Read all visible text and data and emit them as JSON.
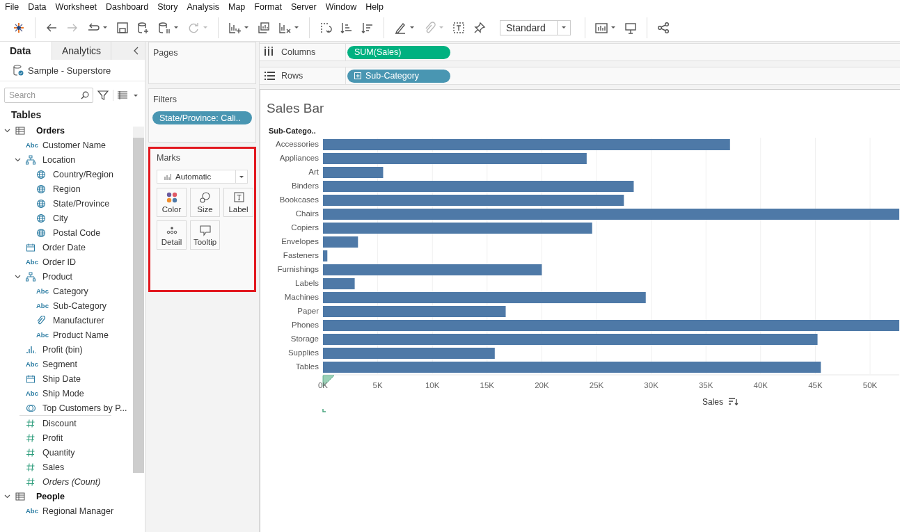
{
  "menu": [
    "File",
    "Data",
    "Worksheet",
    "Dashboard",
    "Story",
    "Analysis",
    "Map",
    "Format",
    "Server",
    "Window",
    "Help"
  ],
  "toolbar": {
    "fit_dropdown": "Standard"
  },
  "side_tabs": [
    {
      "label": "Data",
      "selected": true
    },
    {
      "label": "Analytics",
      "selected": false
    }
  ],
  "data_source": "Sample - Superstore",
  "search": {
    "placeholder": "Search"
  },
  "tables_heading": "Tables",
  "tree": [
    {
      "label": "Orders",
      "kind": "table",
      "expanded": true,
      "children": [
        {
          "label": "Customer Name",
          "kind": "text",
          "type_label": "Abc"
        },
        {
          "label": "Location",
          "kind": "hierarchy",
          "expanded": true,
          "children": [
            {
              "label": "Country/Region",
              "kind": "geo"
            },
            {
              "label": "Region",
              "kind": "geo"
            },
            {
              "label": "State/Province",
              "kind": "geo"
            },
            {
              "label": "City",
              "kind": "geo"
            },
            {
              "label": "Postal Code",
              "kind": "geo"
            }
          ]
        },
        {
          "label": "Order Date",
          "kind": "date"
        },
        {
          "label": "Order ID",
          "kind": "text",
          "type_label": "Abc"
        },
        {
          "label": "Product",
          "kind": "hierarchy",
          "expanded": true,
          "children": [
            {
              "label": "Category",
              "kind": "text",
              "type_label": "Abc"
            },
            {
              "label": "Sub-Category",
              "kind": "text",
              "type_label": "Abc"
            },
            {
              "label": "Manufacturer",
              "kind": "clip"
            },
            {
              "label": "Product Name",
              "kind": "text",
              "type_label": "Abc"
            }
          ]
        },
        {
          "label": "Profit (bin)",
          "kind": "bin"
        },
        {
          "label": "Segment",
          "kind": "text",
          "type_label": "Abc"
        },
        {
          "label": "Ship Date",
          "kind": "date"
        },
        {
          "label": "Ship Mode",
          "kind": "text",
          "type_label": "Abc"
        },
        {
          "label": "Top Customers by P...",
          "kind": "set"
        },
        {
          "label": "Discount",
          "kind": "measure",
          "divider_before": true
        },
        {
          "label": "Profit",
          "kind": "measure"
        },
        {
          "label": "Quantity",
          "kind": "measure"
        },
        {
          "label": "Sales",
          "kind": "measure"
        },
        {
          "label": "Orders (Count)",
          "kind": "measure",
          "italic": true
        }
      ]
    },
    {
      "label": "People",
      "kind": "table",
      "expanded": true,
      "children": [
        {
          "label": "Regional Manager",
          "kind": "text",
          "type_label": "Abc"
        }
      ]
    }
  ],
  "pages": {
    "title": "Pages"
  },
  "filters": {
    "title": "Filters",
    "pills": [
      {
        "label": "State/Province: Cali..",
        "kind": "dimension"
      }
    ]
  },
  "marks": {
    "title": "Marks",
    "type": "Automatic",
    "highlighted": true,
    "buttons": [
      {
        "label": "Color",
        "kind": "color"
      },
      {
        "label": "Size",
        "kind": "size"
      },
      {
        "label": "Label",
        "kind": "label"
      },
      {
        "label": "Detail",
        "kind": "detail"
      },
      {
        "label": "Tooltip",
        "kind": "tooltip"
      }
    ]
  },
  "shelves": [
    {
      "label": "Columns",
      "kind": "columns",
      "pill": {
        "label": "SUM(Sales)",
        "kind": "measure"
      }
    },
    {
      "label": "Rows",
      "kind": "rows",
      "pill": {
        "label": "Sub-Category",
        "kind": "dimension"
      }
    }
  ],
  "view": {
    "title": "Sales Bar",
    "row_header": "Sub-Catego..",
    "chart_data": {
      "type": "bar",
      "orientation": "horizontal",
      "xlabel": "Sales",
      "categories": [
        "Accessories",
        "Appliances",
        "Art",
        "Binders",
        "Bookcases",
        "Chairs",
        "Copiers",
        "Envelopes",
        "Fasteners",
        "Furnishings",
        "Labels",
        "Machines",
        "Paper",
        "Phones",
        "Storage",
        "Supplies",
        "Tables"
      ],
      "series": [
        {
          "color": "#4e79a7",
          "values": [
            37200,
            24100,
            5500,
            28400,
            27500,
            52700,
            24600,
            3200,
            400,
            20000,
            2900,
            29500,
            16700,
            52700,
            45200,
            15700,
            45500
          ]
        }
      ],
      "grid": true,
      "xlim": [
        0,
        52700
      ],
      "xticks": [
        {
          "value": 0,
          "label": "0K"
        },
        {
          "value": 5000,
          "label": "5K"
        },
        {
          "value": 10000,
          "label": "10K"
        },
        {
          "value": 15000,
          "label": "15K"
        },
        {
          "value": 20000,
          "label": "20K"
        },
        {
          "value": 25000,
          "label": "25K"
        },
        {
          "value": 30000,
          "label": "30K"
        },
        {
          "value": 35000,
          "label": "35K"
        },
        {
          "value": 40000,
          "label": "40K"
        },
        {
          "value": 45000,
          "label": "45K"
        },
        {
          "value": 50000,
          "label": "50K"
        }
      ]
    }
  }
}
